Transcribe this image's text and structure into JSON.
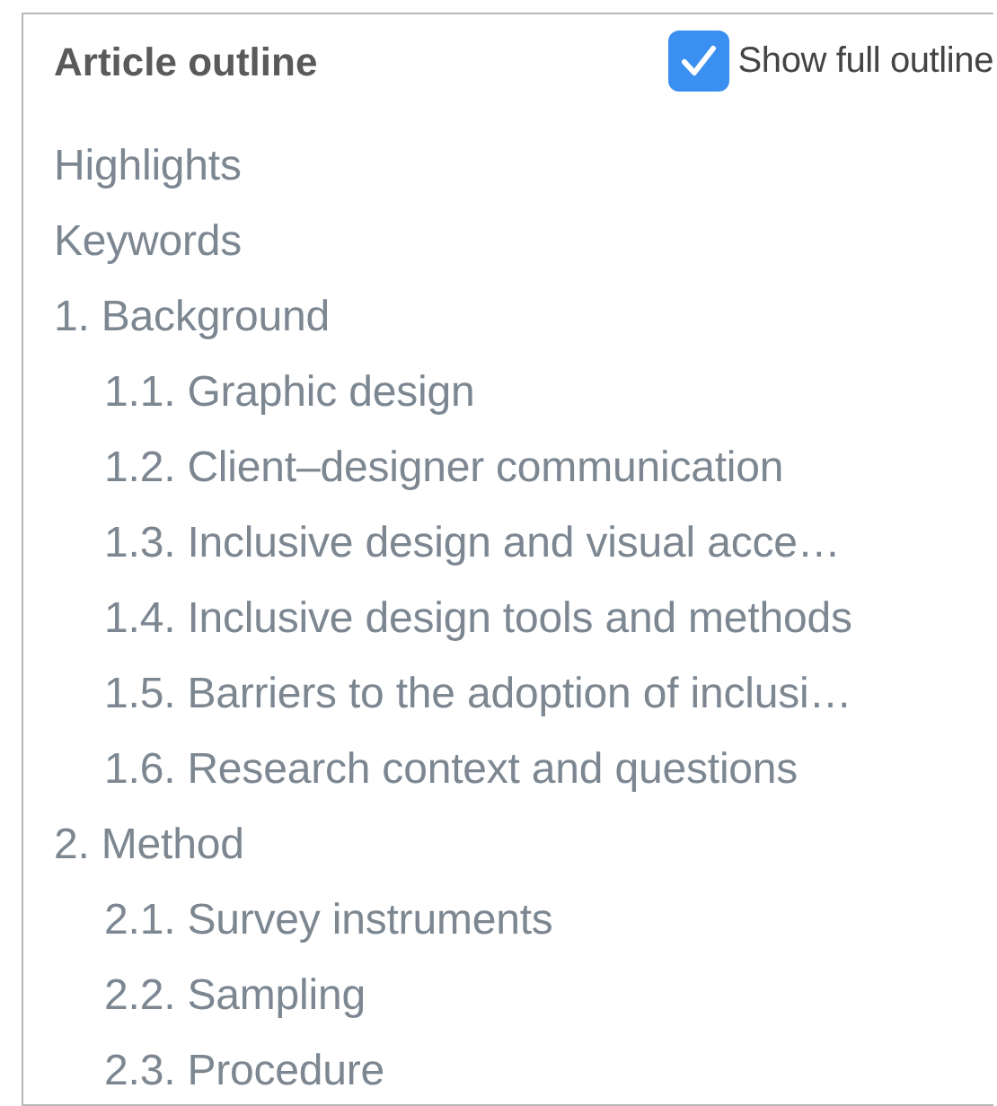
{
  "panel": {
    "title": "Article outline",
    "show_full_outline": {
      "label": "Show full outline",
      "checked": true
    }
  },
  "outline": [
    {
      "label": "Highlights"
    },
    {
      "label": "Keywords"
    },
    {
      "label": "1. Background",
      "children": [
        {
          "label": "1.1. Graphic design"
        },
        {
          "label": "1.2. Client–designer communication"
        },
        {
          "label": "1.3. Inclusive design and visual acce…"
        },
        {
          "label": "1.4. Inclusive design tools and methods"
        },
        {
          "label": "1.5. Barriers to the adoption of inclusi…"
        },
        {
          "label": "1.6. Research context and questions"
        }
      ]
    },
    {
      "label": "2. Method",
      "children": [
        {
          "label": "2.1. Survey instruments"
        },
        {
          "label": "2.2. Sampling"
        },
        {
          "label": "2.3. Procedure"
        }
      ]
    }
  ]
}
